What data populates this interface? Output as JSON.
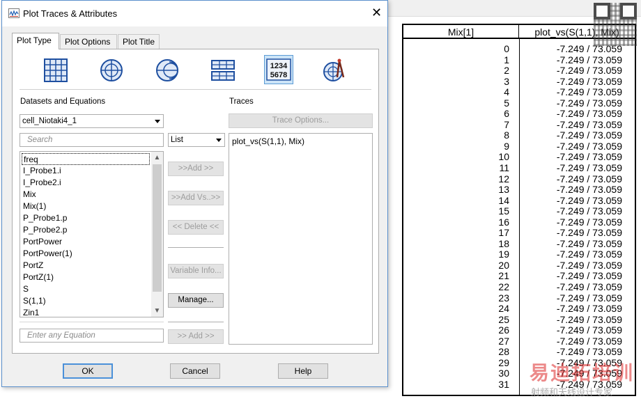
{
  "dialog": {
    "title": "Plot Traces & Attributes",
    "close_glyph": "✕",
    "tabs": [
      {
        "label": "Plot Type",
        "active": true
      },
      {
        "label": "Plot Options",
        "active": false
      },
      {
        "label": "Plot Title",
        "active": false
      }
    ],
    "plot_types": [
      {
        "icon": "rectangular-plot-icon",
        "selected": false
      },
      {
        "icon": "polar-plot-icon",
        "selected": false
      },
      {
        "icon": "smith-chart-icon",
        "selected": false
      },
      {
        "icon": "stacked-plot-icon",
        "selected": false
      },
      {
        "icon": "list-table-icon",
        "selected": true,
        "text_line1": "1234",
        "text_line2": "5678"
      },
      {
        "icon": "antenna-plot-icon",
        "selected": false
      }
    ],
    "datasets_label": "Datasets and Equations",
    "traces_label": "Traces",
    "dataset_selected": "cell_Niotaki4_1",
    "search_placeholder": "Search",
    "view_mode_selected": "List",
    "variables": [
      "freq",
      "I_Probe1.i",
      "I_Probe2.i",
      "Mix",
      "Mix(1)",
      "P_Probe1.p",
      "P_Probe2.p",
      "PortPower",
      "PortPower(1)",
      "PortZ",
      "PortZ(1)",
      "S",
      "S(1,1)",
      "Zin1"
    ],
    "buttons": {
      "add": ">>Add >>",
      "add_vs": ">>Add Vs..>>",
      "delete": "<< Delete <<",
      "variable_info": "Variable Info...",
      "manage": "Manage...",
      "trace_options": "Trace Options...",
      "add_equation": ">> Add >>",
      "ok": "OK",
      "cancel": "Cancel",
      "help": "Help"
    },
    "equation_placeholder": "Enter any Equation",
    "traces": [
      "plot_vs(S(1,1), Mix)"
    ]
  },
  "table": {
    "columns": [
      "Mix[1]",
      "plot_vs(S(1,1), Mix)"
    ],
    "rows": [
      [
        "0",
        "-7.249 / 73.059"
      ],
      [
        "1",
        "-7.249 / 73.059"
      ],
      [
        "2",
        "-7.249 / 73.059"
      ],
      [
        "3",
        "-7.249 / 73.059"
      ],
      [
        "4",
        "-7.249 / 73.059"
      ],
      [
        "5",
        "-7.249 / 73.059"
      ],
      [
        "6",
        "-7.249 / 73.059"
      ],
      [
        "7",
        "-7.249 / 73.059"
      ],
      [
        "8",
        "-7.249 / 73.059"
      ],
      [
        "9",
        "-7.249 / 73.059"
      ],
      [
        "10",
        "-7.249 / 73.059"
      ],
      [
        "11",
        "-7.249 / 73.059"
      ],
      [
        "12",
        "-7.249 / 73.059"
      ],
      [
        "13",
        "-7.249 / 73.059"
      ],
      [
        "14",
        "-7.249 / 73.059"
      ],
      [
        "15",
        "-7.249 / 73.059"
      ],
      [
        "16",
        "-7.249 / 73.059"
      ],
      [
        "17",
        "-7.249 / 73.059"
      ],
      [
        "18",
        "-7.249 / 73.059"
      ],
      [
        "19",
        "-7.249 / 73.059"
      ],
      [
        "20",
        "-7.249 / 73.059"
      ],
      [
        "21",
        "-7.249 / 73.059"
      ],
      [
        "22",
        "-7.249 / 73.059"
      ],
      [
        "23",
        "-7.249 / 73.059"
      ],
      [
        "24",
        "-7.249 / 73.059"
      ],
      [
        "25",
        "-7.249 / 73.059"
      ],
      [
        "26",
        "-7.249 / 73.059"
      ],
      [
        "27",
        "-7.249 / 73.059"
      ],
      [
        "28",
        "-7.249 / 73.059"
      ],
      [
        "29",
        "-7.249 / 73.059"
      ],
      [
        "30",
        "-7.249 / 73.059"
      ],
      [
        "31",
        "-7.249 / 73.059"
      ]
    ]
  },
  "watermark": {
    "logo_text": "易迪拓培训",
    "subtitle": "射频和天线设计专家"
  }
}
